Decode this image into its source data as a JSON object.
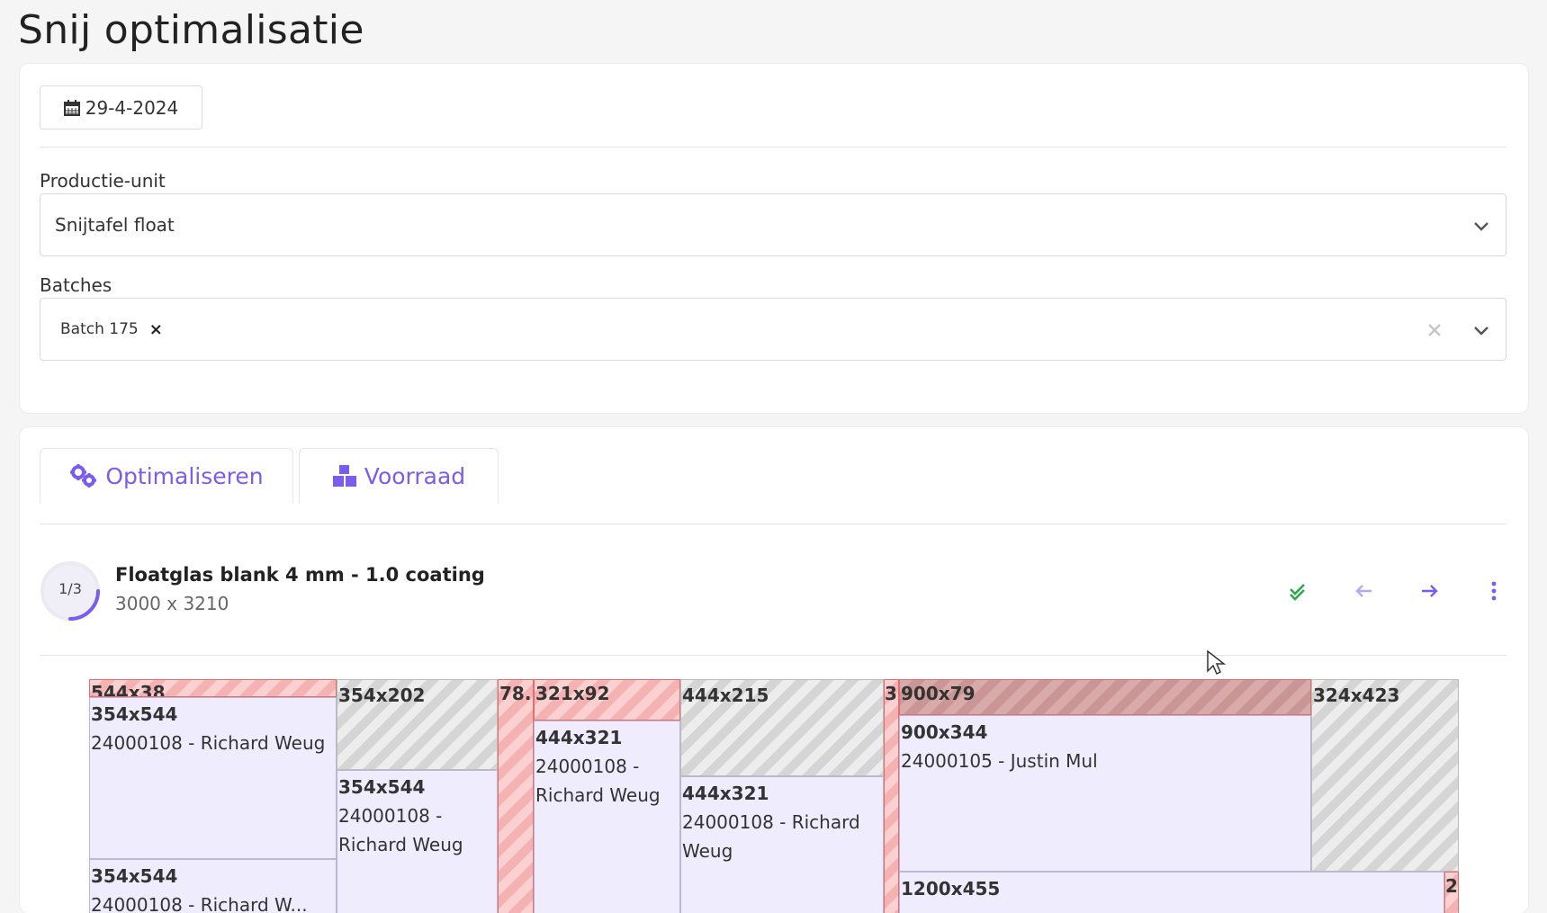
{
  "page": {
    "title": "Snij optimalisatie"
  },
  "filters": {
    "date": "29-4-2024",
    "production_unit": {
      "label": "Productie-unit",
      "value": "Snijtafel float"
    },
    "batches": {
      "label": "Batches",
      "selected": [
        "Batch 175"
      ],
      "remove_symbol": "×"
    }
  },
  "tabs": [
    {
      "label": "Optimaliseren",
      "icon": "gears-icon"
    },
    {
      "label": "Voorraad",
      "icon": "boxes-icon"
    }
  ],
  "sheet": {
    "progress": "1/3",
    "progress_fraction": 0.333,
    "title": "Floatglas blank 4 mm - 1.0 coating",
    "dimensions": "3000 x 3210",
    "actions": [
      "check-double-icon",
      "arrow-left-icon",
      "arrow-right-icon",
      "more-vertical-icon"
    ]
  },
  "layout": {
    "strips": [
      "544x38",
      "78...",
      "321x92",
      "3",
      "900x79",
      "2"
    ],
    "waste": [
      "354x202",
      "444x215",
      "324x423"
    ],
    "pieces": [
      {
        "dims": "354x544",
        "label": "24000108 - Richard Weug"
      },
      {
        "dims": "354x544",
        "label": "24000108 - Richard Weug"
      },
      {
        "dims": "354x544",
        "label": "24000108 - Richard W..."
      },
      {
        "dims": "444x321",
        "label": "24000108 - Richard Weug"
      },
      {
        "dims": "444x321",
        "label": "24000108 - Richard Weug"
      },
      {
        "dims": "900x344",
        "label": "24000105 - Justin Mul"
      },
      {
        "dims": "1200x455",
        "label": ""
      }
    ]
  },
  "colors": {
    "accent": "#7a5cf0",
    "success": "#2fa84f",
    "waste_red": "#f4b2b2",
    "piece": "#efedfd"
  }
}
